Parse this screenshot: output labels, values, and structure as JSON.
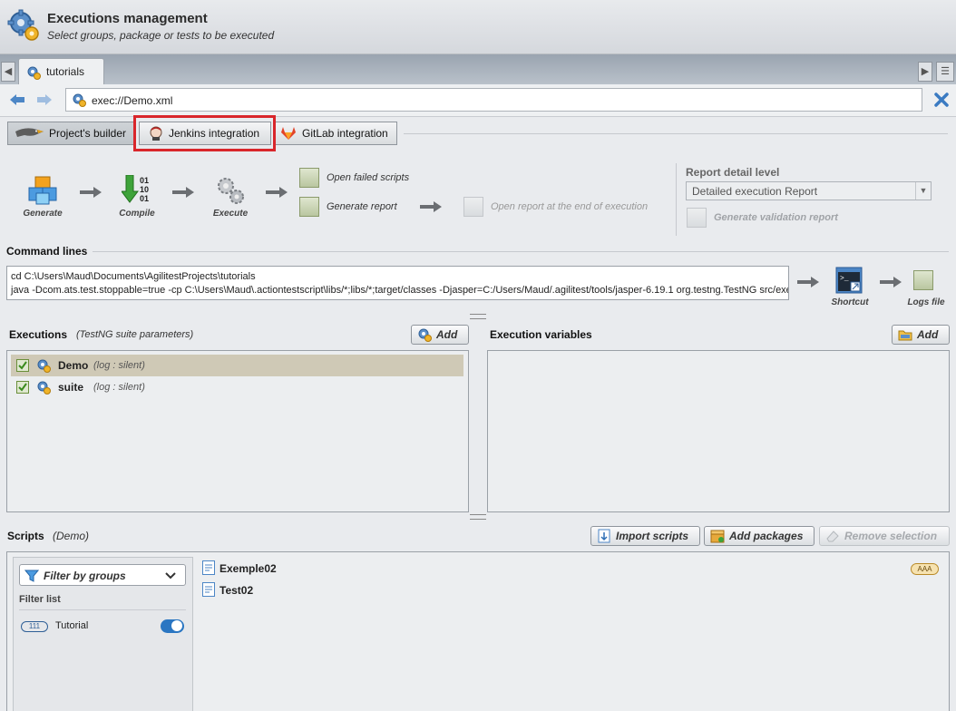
{
  "header": {
    "title": "Executions management",
    "subtitle": "Select groups, package or tests to be executed"
  },
  "tabs": [
    {
      "label": "tutorials"
    }
  ],
  "address": {
    "url": "exec://Demo.xml"
  },
  "subtabs": [
    {
      "label": "Project's builder"
    },
    {
      "label": "Jenkins integration"
    },
    {
      "label": "GitLab integration"
    }
  ],
  "flow": {
    "generate": "Generate",
    "compile": "Compile",
    "execute": "Execute",
    "open_failed": "Open failed scripts",
    "generate_report": "Generate report",
    "open_report_end": "Open  report at the end of execution"
  },
  "report": {
    "title": "Report detail level",
    "level_value": "Detailed execution Report",
    "generate_validation": "Generate validation report"
  },
  "command": {
    "title": "Command lines",
    "line1": "cd C:\\Users\\Maud\\Documents\\AgilitestProjects\\tutorials",
    "line2": "java -Dcom.ats.test.stoppable=true -cp C:\\Users\\Maud\\.actiontestscript\\libs/*;libs/*;target/classes -Djasper=C:/Users/Maud/.agilitest/tools/jasper-6.19.1 org.testng.TestNG src/exec",
    "shortcut": "Shortcut",
    "logs": "Logs file"
  },
  "executions": {
    "title": "Executions",
    "subtitle": "(TestNG suite parameters)",
    "add": "Add",
    "items": [
      {
        "name": "Demo",
        "meta": "(log : silent)"
      },
      {
        "name": "suite",
        "meta": "(log : silent)"
      }
    ]
  },
  "variables": {
    "title": "Execution variables",
    "add": "Add"
  },
  "scripts": {
    "title": "Scripts",
    "subtitle": "(Demo)",
    "import": "Import scripts",
    "add_packages": "Add packages",
    "remove": "Remove selection",
    "filter_by": "Filter by groups",
    "filter_list": "Filter list",
    "group_badge": "111",
    "group_name": "Tutorial",
    "items": [
      {
        "name": "Exemple02"
      },
      {
        "name": "Test02"
      }
    ],
    "aaa_badge": "AAA"
  }
}
